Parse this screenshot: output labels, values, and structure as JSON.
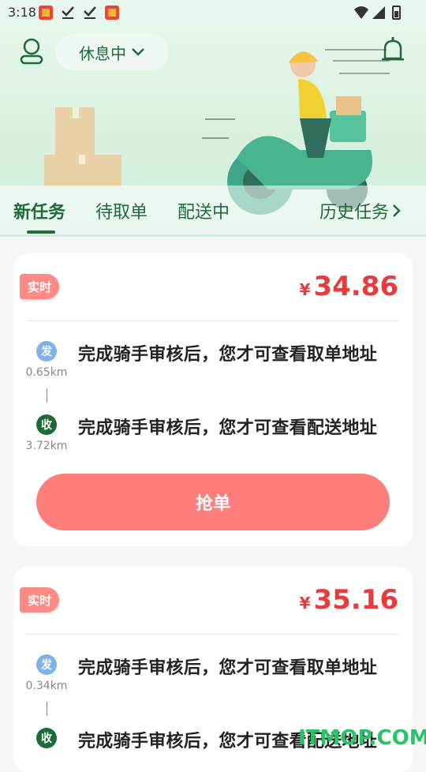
{
  "status_bar": {
    "time": "3:18"
  },
  "header": {
    "work_status": "休息中"
  },
  "tabs": [
    {
      "label": "新任务"
    },
    {
      "label": "待取单"
    },
    {
      "label": "配送中"
    },
    {
      "label": "历史任务"
    }
  ],
  "orders": [
    {
      "tag": "实时",
      "currency": "¥",
      "price": "34.86",
      "pickup": {
        "icon_label": "发",
        "distance": "0.65km",
        "text": "完成骑手审核后，您才可查看取单地址"
      },
      "dropoff": {
        "icon_label": "收",
        "distance": "3.72km",
        "text": "完成骑手审核后，您才可查看配送地址"
      },
      "button": "抢单"
    },
    {
      "tag": "实时",
      "currency": "¥",
      "price": "35.16",
      "pickup": {
        "icon_label": "发",
        "distance": "0.34km",
        "text": "完成骑手审核后，您才可查看取单地址"
      },
      "dropoff": {
        "icon_label": "收",
        "distance": "",
        "text": "完成骑手审核后，您才可查看配送地址"
      }
    }
  ],
  "watermark": "ITMOP.COM",
  "colors": {
    "primary": "#1e6b39",
    "price": "#e83b3b",
    "button": "#ff7e7b",
    "badge": "#ff8a85"
  }
}
